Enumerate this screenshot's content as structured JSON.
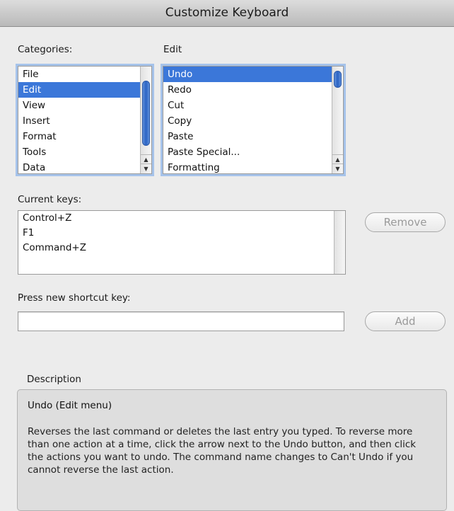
{
  "window": {
    "title": "Customize Keyboard"
  },
  "categories": {
    "label": "Categories:",
    "items": [
      "File",
      "Edit",
      "View",
      "Insert",
      "Format",
      "Tools",
      "Data"
    ],
    "selected": "Edit"
  },
  "commands": {
    "label": "Edit",
    "items": [
      "Undo",
      "Redo",
      "Cut",
      "Copy",
      "Paste",
      "Paste Special...",
      "Formatting"
    ],
    "selected": "Undo"
  },
  "current_keys": {
    "label": "Current keys:",
    "items": [
      "Control+Z",
      "F1",
      "Command+Z"
    ],
    "remove_label": "Remove"
  },
  "new_shortcut": {
    "label": "Press new shortcut key:",
    "value": "",
    "add_label": "Add"
  },
  "description": {
    "label": "Description",
    "heading": "Undo (Edit menu)",
    "body": "Reverses the last command or deletes the last entry you typed. To reverse more than one action at a time, click the arrow next to the Undo button, and then click the actions you want to undo. The command name changes to Can't Undo if you cannot reverse the last action."
  },
  "colors": {
    "selection": "#3b77d9",
    "focus_ring": "#a6c3ea",
    "background": "#ececec"
  }
}
